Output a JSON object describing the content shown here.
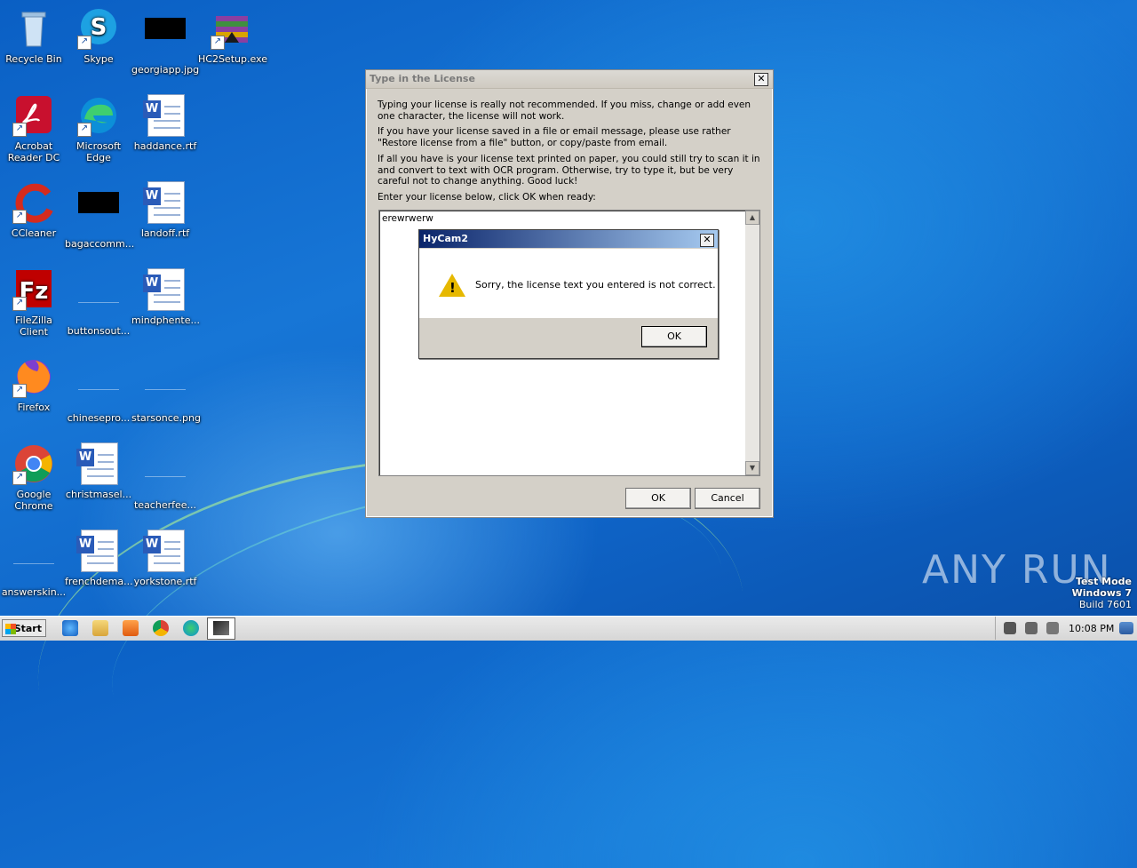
{
  "desktop": {
    "icons": [
      {
        "label": "Recycle Bin",
        "icon": "recycle-bin-icon"
      },
      {
        "label": "Skype",
        "icon": "skype-icon"
      },
      {
        "label": "georgiapp.jpg",
        "icon": "image-file-icon"
      },
      {
        "label": "HC2Setup.exe",
        "icon": "installer-icon"
      },
      {
        "label": "Acrobat Reader DC",
        "icon": "acrobat-icon"
      },
      {
        "label": "Microsoft Edge",
        "icon": "edge-icon"
      },
      {
        "label": "haddance.rtf",
        "icon": "word-doc-icon"
      },
      {
        "label": "CCleaner",
        "icon": "ccleaner-icon"
      },
      {
        "label": "bagaccomm...",
        "icon": "image-file-icon"
      },
      {
        "label": "landoff.rtf",
        "icon": "word-doc-icon"
      },
      {
        "label": "FileZilla Client",
        "icon": "filezilla-icon"
      },
      {
        "label": "buttonsout...",
        "icon": "file-icon"
      },
      {
        "label": "mindphente...",
        "icon": "word-doc-icon"
      },
      {
        "label": "Firefox",
        "icon": "firefox-icon"
      },
      {
        "label": "chinesepro...",
        "icon": "file-icon"
      },
      {
        "label": "starsonce.png",
        "icon": "file-icon"
      },
      {
        "label": "Google Chrome",
        "icon": "chrome-icon"
      },
      {
        "label": "christmasel...",
        "icon": "word-doc-icon"
      },
      {
        "label": "teacherfee...",
        "icon": "file-icon"
      },
      {
        "label": "answerskin...",
        "icon": "file-icon"
      },
      {
        "label": "frenchdema...",
        "icon": "word-doc-icon"
      },
      {
        "label": "yorkstone.rtf",
        "icon": "word-doc-icon"
      }
    ]
  },
  "license_window": {
    "title": "Type in the License",
    "p1": "Typing your license is really not recommended. If you miss, change or add even one character, the license will not work.",
    "p2": "If you have your license saved in a file or email message, please use rather \"Restore license from a file\" button, or copy/paste from email.",
    "p3": "If all you have is your license text printed on paper, you could still try to scan it in and convert to text with OCR program. Otherwise, try to type it, but be very careful not to change anything. Good luck!",
    "p4": "Enter your license below, click OK when ready:",
    "license_value": "erewrwerw",
    "ok_label": "OK",
    "cancel_label": "Cancel"
  },
  "error_dialog": {
    "title": "HyCam2",
    "message": "Sorry, the license text you entered is not correct.",
    "ok_label": "OK"
  },
  "taskbar": {
    "start_label": "Start",
    "time": "10:08 PM"
  },
  "watermark": {
    "line1": "Test Mode",
    "line2": "Windows 7",
    "line3": "Build 7601",
    "brand": "ANY RUN"
  }
}
